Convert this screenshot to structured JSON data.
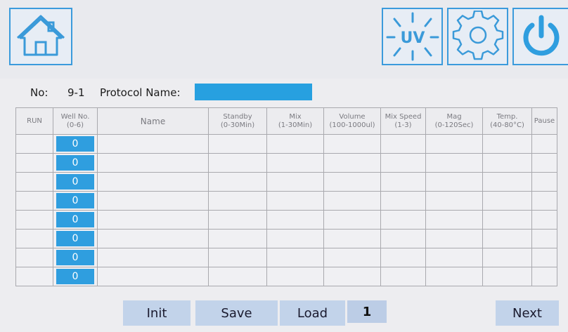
{
  "header": {
    "icons": {
      "home": "home-icon",
      "uv": "uv-lamp-icon",
      "settings": "gear-icon",
      "power": "power-icon"
    },
    "uv_label": "UV"
  },
  "protocol": {
    "no_label": "No:",
    "no_value": "9-1",
    "name_label": "Protocol Name:",
    "name_value": ""
  },
  "table": {
    "columns": [
      {
        "title": "RUN",
        "range": ""
      },
      {
        "title": "Well No.",
        "range": "(0-6)"
      },
      {
        "title": "Name",
        "range": ""
      },
      {
        "title": "Standby",
        "range": "(0-30Min)"
      },
      {
        "title": "Mix",
        "range": "(1-30Min)"
      },
      {
        "title": "Volume",
        "range": "(100-1000ul)"
      },
      {
        "title": "Mix Speed",
        "range": "(1-3)"
      },
      {
        "title": "Mag",
        "range": "(0-120Sec)"
      },
      {
        "title": "Temp.",
        "range": "(40-80°C)"
      },
      {
        "title": "Pause",
        "range": ""
      }
    ],
    "rows": [
      {
        "run": "",
        "well": "0",
        "name": "",
        "standby": "",
        "mix": "",
        "volume": "",
        "mix_speed": "",
        "mag": "",
        "temp": "",
        "pause": ""
      },
      {
        "run": "",
        "well": "0",
        "name": "",
        "standby": "",
        "mix": "",
        "volume": "",
        "mix_speed": "",
        "mag": "",
        "temp": "",
        "pause": ""
      },
      {
        "run": "",
        "well": "0",
        "name": "",
        "standby": "",
        "mix": "",
        "volume": "",
        "mix_speed": "",
        "mag": "",
        "temp": "",
        "pause": ""
      },
      {
        "run": "",
        "well": "0",
        "name": "",
        "standby": "",
        "mix": "",
        "volume": "",
        "mix_speed": "",
        "mag": "",
        "temp": "",
        "pause": ""
      },
      {
        "run": "",
        "well": "0",
        "name": "",
        "standby": "",
        "mix": "",
        "volume": "",
        "mix_speed": "",
        "mag": "",
        "temp": "",
        "pause": ""
      },
      {
        "run": "",
        "well": "0",
        "name": "",
        "standby": "",
        "mix": "",
        "volume": "",
        "mix_speed": "",
        "mag": "",
        "temp": "",
        "pause": ""
      },
      {
        "run": "",
        "well": "0",
        "name": "",
        "standby": "",
        "mix": "",
        "volume": "",
        "mix_speed": "",
        "mag": "",
        "temp": "",
        "pause": ""
      },
      {
        "run": "",
        "well": "0",
        "name": "",
        "standby": "",
        "mix": "",
        "volume": "",
        "mix_speed": "",
        "mag": "",
        "temp": "",
        "pause": ""
      }
    ]
  },
  "footer": {
    "init_label": "Init",
    "save_label": "Save",
    "load_label": "Load",
    "page": "1",
    "next_label": "Next"
  },
  "colors": {
    "accent": "#2f9edf",
    "button": "#c2d3ea",
    "background": "#ededf0"
  }
}
